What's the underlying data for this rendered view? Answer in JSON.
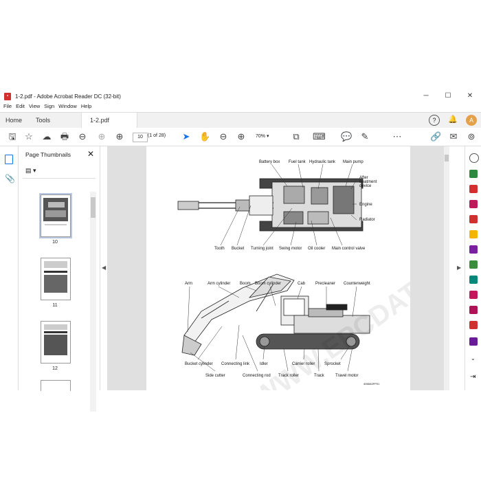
{
  "window": {
    "title": "1-2.pdf - Adobe Acrobat Reader DC (32-bit)",
    "minimize": "─",
    "maximize": "☐",
    "close": "✕"
  },
  "menu": [
    "File",
    "Edit",
    "View",
    "Sign",
    "Window",
    "Help"
  ],
  "tabs": {
    "home": "Home",
    "tools": "Tools",
    "doc": "1-2.pdf"
  },
  "toolbar": {
    "page_value": "10",
    "page_count": "(1 of 28)",
    "zoom": "70%"
  },
  "panel": {
    "title": "Page Thumbnails",
    "thumb_labels": [
      "10",
      "11",
      "12"
    ]
  },
  "diagram_top": {
    "labels": [
      "Battery box",
      "Fuel tank",
      "Hydraulic tank",
      "Main pump",
      "After",
      "treatment",
      "device",
      "Engine",
      "Radiator",
      "Tooth",
      "Bucket",
      "Turning joint",
      "Swing motor",
      "Oil cooler",
      "Main control valve"
    ]
  },
  "diagram_bottom": {
    "labels": [
      "Arm",
      "Arm cylinder",
      "Boom",
      "Boom cylinder",
      "Cab",
      "Precleaner",
      "Counterweight",
      "Bucket cylinder",
      "Connecting link",
      "Idler",
      "Carrier roller",
      "Sprocket",
      "Side cutter",
      "Connecting rod",
      "Track roller",
      "Track",
      "Travel motor"
    ],
    "code": "4066A0FP01"
  },
  "watermark": "WWW.EPCDATA.COM",
  "colors": {
    "viewer_bg": "#e0e0e0",
    "accent": "#1473e6",
    "pdf_red": "#d32f2f"
  }
}
